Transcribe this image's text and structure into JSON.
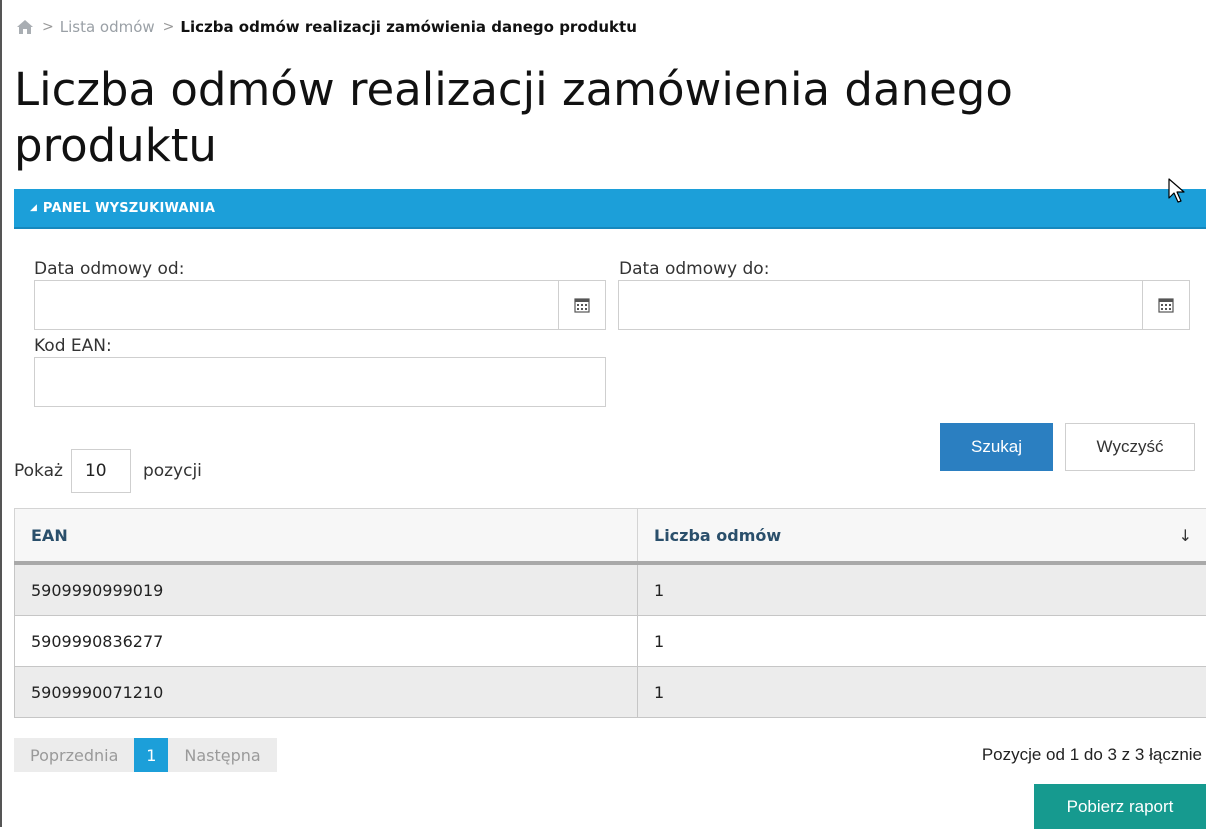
{
  "breadcrumb": {
    "home_icon": "home-icon",
    "separator": ">",
    "link": "Lista odmów",
    "current": "Liczba odmów realizacji zamówienia danego produktu"
  },
  "page_title": "Liczba odmów realizacji zamówienia danego produktu",
  "search_panel": {
    "title": "PANEL WYSZUKIWANIA",
    "collapse_icon": "triangle-icon",
    "fields": {
      "date_from": {
        "label": "Data odmowy od:",
        "value": "",
        "icon": "calendar-icon"
      },
      "date_to": {
        "label": "Data odmowy do:",
        "value": "",
        "icon": "calendar-icon"
      },
      "ean": {
        "label": "Kod EAN:",
        "value": ""
      }
    },
    "search_button": "Szukaj",
    "clear_button": "Wyczyść"
  },
  "page_length": {
    "prefix": "Pokaż",
    "value": "10",
    "suffix": "pozycji"
  },
  "table": {
    "columns": [
      "EAN",
      "Liczba odmów"
    ],
    "sort_indicator": "↓",
    "rows": [
      [
        "5909990999019",
        "1"
      ],
      [
        "5909990836277",
        "1"
      ],
      [
        "5909990071210",
        "1"
      ]
    ]
  },
  "pagination": {
    "previous": "Poprzednia",
    "current": "1",
    "next": "Następna"
  },
  "info": "Pozycje od 1 do 3 z 3 łącznie",
  "report_button": "Pobierz raport",
  "colors": {
    "panel_header": "#1c9fd9",
    "search_button": "#2b7fc1",
    "report_button": "#169a8f",
    "odd_row": "#ececec"
  }
}
